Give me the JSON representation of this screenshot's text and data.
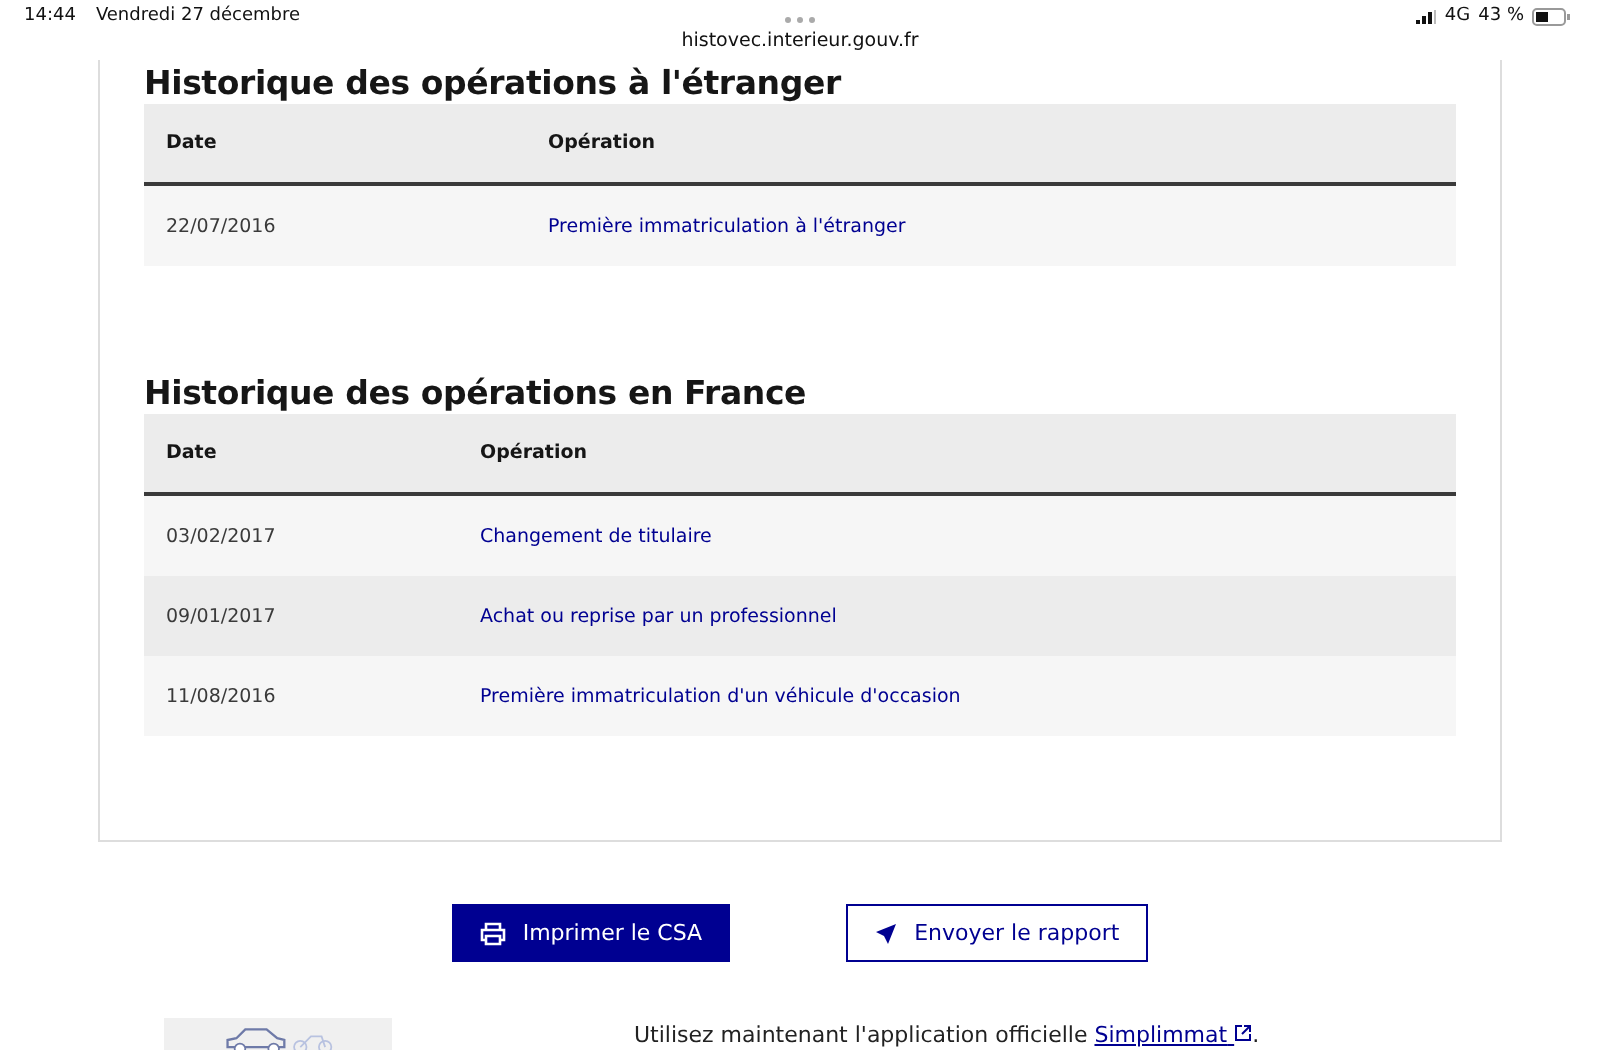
{
  "status_bar": {
    "time": "14:44",
    "date": "Vendredi 27 décembre",
    "network": "4G",
    "battery": "43 %"
  },
  "address_bar": {
    "url": "histovec.interieur.gouv.fr"
  },
  "sections": [
    {
      "title": "Historique des opérations à l'étranger",
      "columns": [
        "Date",
        "Opération"
      ],
      "rows": [
        {
          "date": "22/07/2016",
          "operation": "Première immatriculation à l'étranger"
        }
      ]
    },
    {
      "title": "Historique des opérations en France",
      "columns": [
        "Date",
        "Opération"
      ],
      "rows": [
        {
          "date": "03/02/2017",
          "operation": "Changement de titulaire"
        },
        {
          "date": "09/01/2017",
          "operation": "Achat ou reprise par un professionnel"
        },
        {
          "date": "11/08/2016",
          "operation": "Première immatriculation d'un véhicule d'occasion"
        }
      ]
    }
  ],
  "buttons": [
    {
      "kind": "primary",
      "label": "Imprimer le CSA"
    },
    {
      "kind": "secondary",
      "label": "Envoyer le rapport"
    }
  ],
  "promo": {
    "text": "Utilisez maintenant l'application officielle",
    "link": "Simplimmat",
    "end": "."
  }
}
